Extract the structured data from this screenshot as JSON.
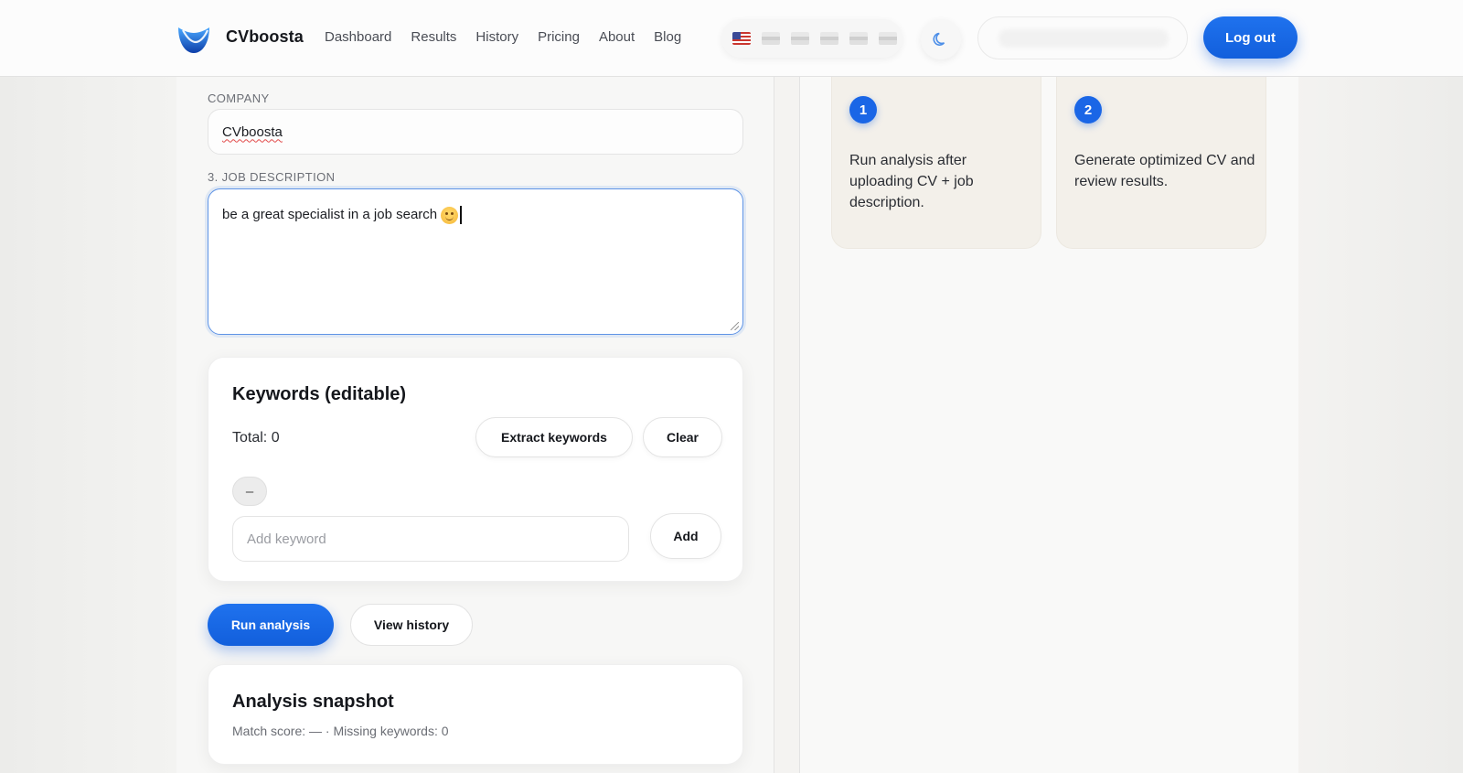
{
  "header": {
    "brand": "CVboosta",
    "nav": [
      "Dashboard",
      "Results",
      "History",
      "Pricing",
      "About",
      "Blog"
    ],
    "logout_label": "Log out",
    "languages": [
      "us-flag",
      "flag",
      "flag",
      "flag",
      "flag",
      "flag"
    ],
    "theme_icon": "moon-icon"
  },
  "form": {
    "company_label": "COMPANY",
    "company_value": "CVboosta",
    "job_label": "3. JOB DESCRIPTION",
    "job_value": "be a great specialist in a job search"
  },
  "keywords": {
    "title": "Keywords (editable)",
    "total": "Total: 0",
    "extract_label": "Extract keywords",
    "clear_label": "Clear",
    "empty_chip": "–",
    "input_placeholder": "Add keyword",
    "add_label": "Add"
  },
  "actions": {
    "run_label": "Run analysis",
    "history_label": "View history"
  },
  "snapshot": {
    "title": "Analysis snapshot",
    "summary": "Match score: — · Missing keywords: 0"
  },
  "steps": [
    {
      "num": "1",
      "text": "Run analysis after uploading CV + job description."
    },
    {
      "num": "2",
      "text": "Generate optimized CV and review results."
    }
  ],
  "colors": {
    "accent": "#1a66e6",
    "step_card_bg": "#f3f0ea"
  }
}
